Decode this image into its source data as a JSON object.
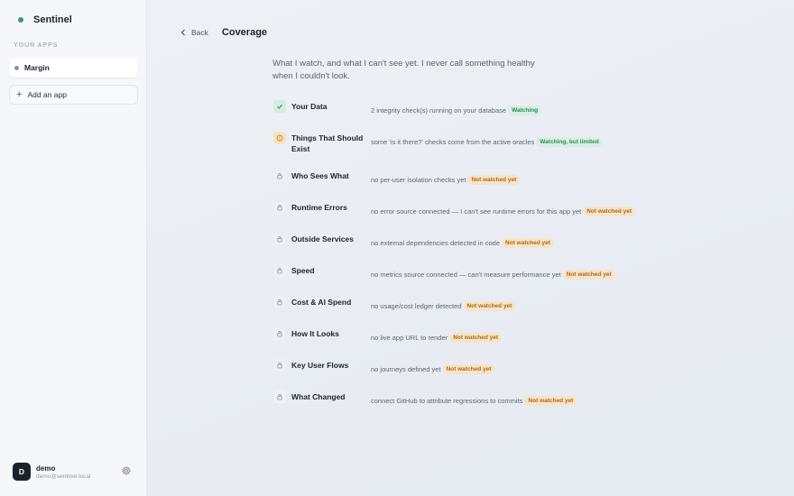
{
  "sidebar": {
    "brand": "Sentinel",
    "section_label": "YOUR APPS",
    "apps": [
      {
        "label": "Margin"
      }
    ],
    "add_app_label": "Add an app",
    "user": {
      "initial": "D",
      "name": "demo",
      "email": "demo@sentinel.local"
    }
  },
  "header": {
    "back_label": "Back",
    "title": "Coverage"
  },
  "intro": "What I watch, and what I can't see yet. I never call something healthy when I couldn't look.",
  "colors": {
    "accent_green": "#3c9a6e",
    "watching_bg": "#d9efe4",
    "not_watched_bg": "#f7e3c9"
  },
  "items": [
    {
      "name": "Your Data",
      "icon": "check-icon",
      "status_kind": "watching",
      "desc": "2 integrity check(s) running on your database",
      "status": "Watching"
    },
    {
      "name": "Things That Should Exist",
      "icon": "warning-icon",
      "status_kind": "limited",
      "desc": "some 'is it there?' checks come from the active oracles",
      "status": "Watching, but limited"
    },
    {
      "name": "Who Sees What",
      "icon": "lock-icon",
      "status_kind": "not-watched",
      "desc": "no per-user isolation checks yet",
      "status": "Not watched yet"
    },
    {
      "name": "Runtime Errors",
      "icon": "lock-icon",
      "status_kind": "not-watched",
      "desc": "no error source connected — I can't see runtime errors for this app yet",
      "status": "Not watched yet"
    },
    {
      "name": "Outside Services",
      "icon": "lock-icon",
      "status_kind": "not-watched",
      "desc": "no external dependencies detected in code",
      "status": "Not watched yet"
    },
    {
      "name": "Speed",
      "icon": "lock-icon",
      "status_kind": "not-watched",
      "desc": "no metrics source connected — can't measure performance yet",
      "status": "Not watched yet"
    },
    {
      "name": "Cost & AI Spend",
      "icon": "lock-icon",
      "status_kind": "not-watched",
      "desc": "no usage/cost ledger detected",
      "status": "Not watched yet"
    },
    {
      "name": "How It Looks",
      "icon": "lock-icon",
      "status_kind": "not-watched",
      "desc": "no live app URL to render",
      "status": "Not watched yet"
    },
    {
      "name": "Key User Flows",
      "icon": "lock-icon",
      "status_kind": "not-watched",
      "desc": "no journeys defined yet",
      "status": "Not watched yet"
    },
    {
      "name": "What Changed",
      "icon": "lock-icon",
      "status_kind": "not-watched",
      "desc": "connect GitHub to attribute regressions to commits",
      "status": "Not watched yet"
    }
  ]
}
